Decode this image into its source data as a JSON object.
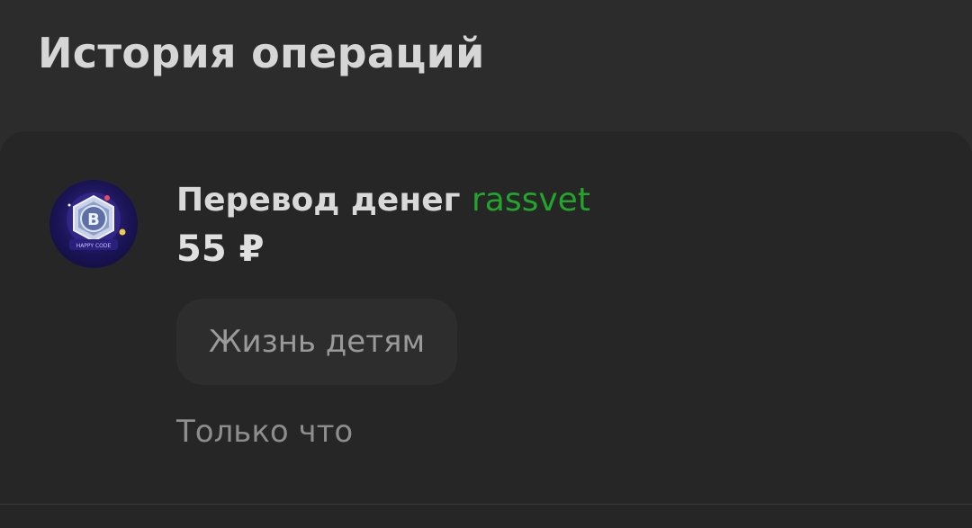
{
  "header": {
    "title": "История операций"
  },
  "operation": {
    "avatar_icon": "bitcoin-coin-icon",
    "avatar_caption": "HAPPY CODE",
    "title_prefix": "Перевод денег",
    "recipient": "rassvet",
    "amount": "55 ₽",
    "tag": "Жизнь детям",
    "time": "Только что"
  },
  "colors": {
    "background": "#2c2c2c",
    "card": "#262626",
    "recipient_accent": "#22a52b",
    "chip": "#2d2d2d"
  }
}
